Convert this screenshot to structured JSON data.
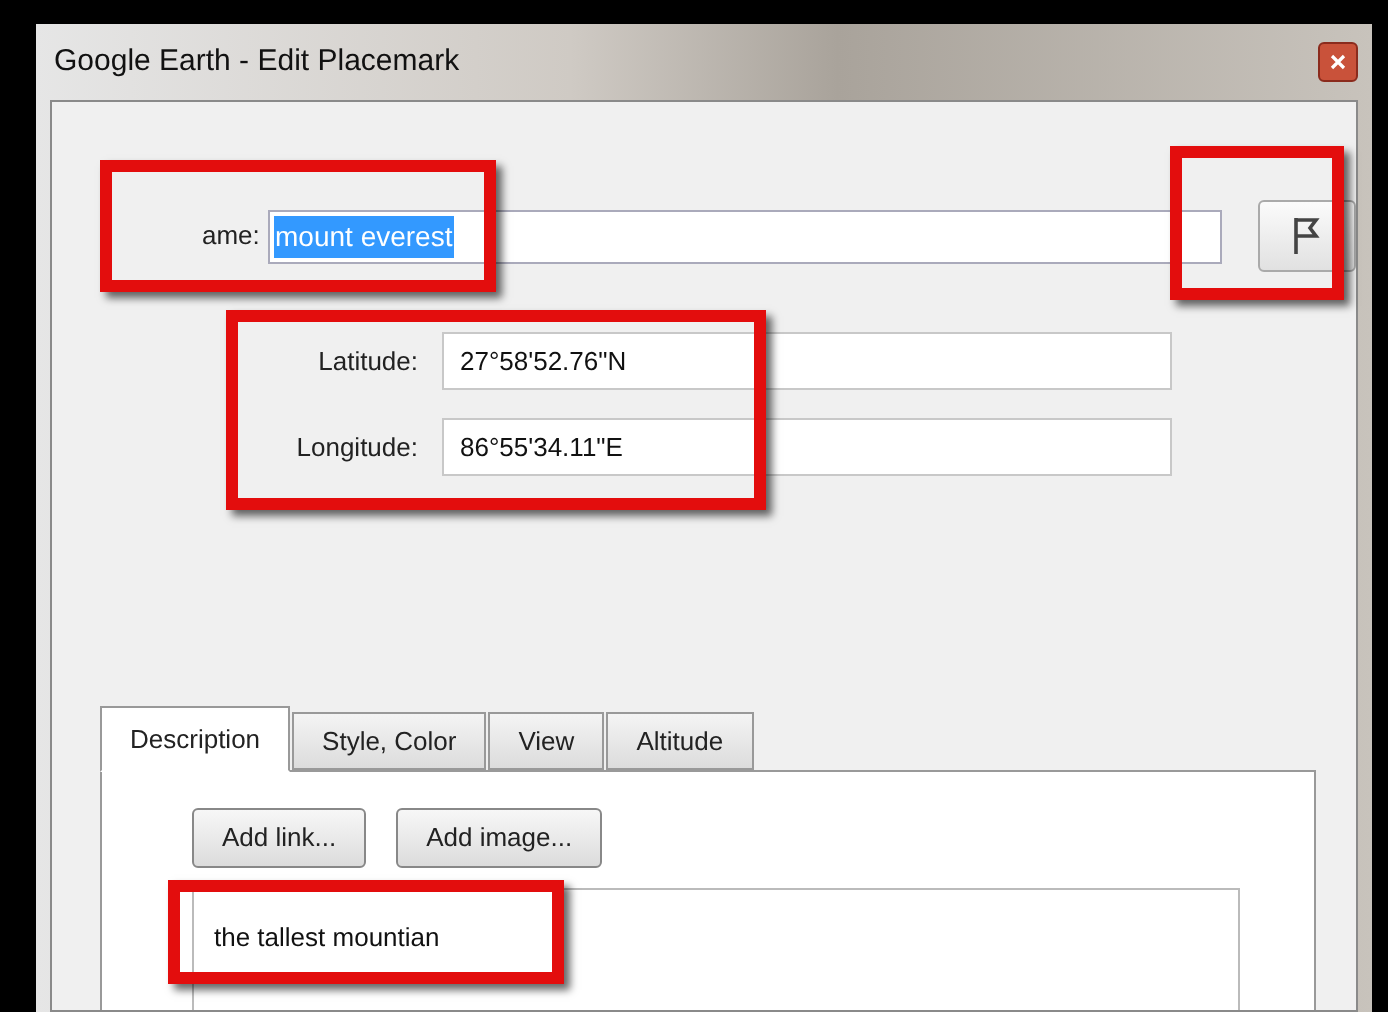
{
  "window": {
    "title": "Google Earth - Edit Placemark"
  },
  "name_field": {
    "label": "ame:",
    "value": "mount everest",
    "selected_text": true
  },
  "coordinates": [
    {
      "label": "Latitude:",
      "value": "27°58'52.76\"N"
    },
    {
      "label": "Longitude:",
      "value": "86°55'34.11\"E"
    }
  ],
  "tabs": [
    {
      "label": "Description",
      "selected": true
    },
    {
      "label": "Style, Color",
      "selected": false
    },
    {
      "label": "View",
      "selected": false
    },
    {
      "label": "Altitude",
      "selected": false
    }
  ],
  "buttons": [
    "Add link...",
    "Add image..."
  ],
  "description": {
    "value": "the tallest mountian"
  }
}
